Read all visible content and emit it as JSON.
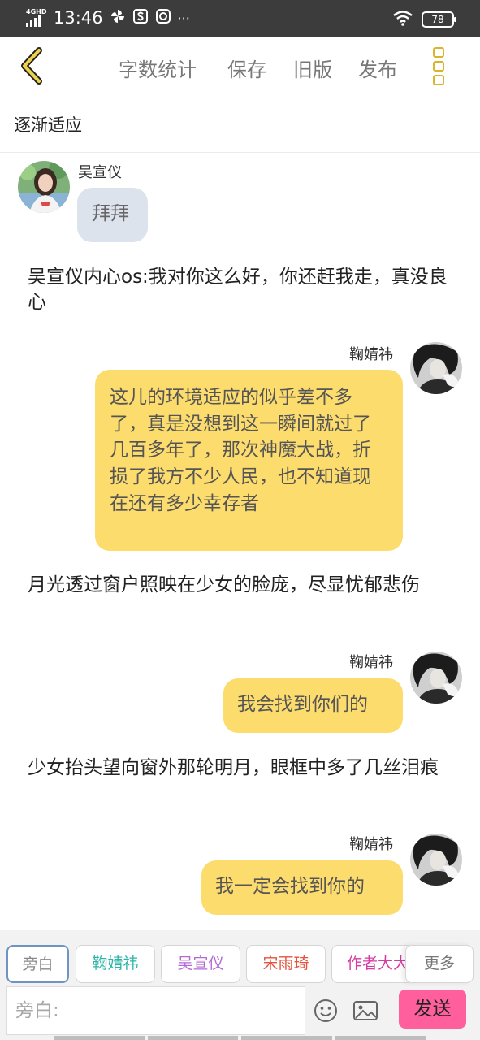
{
  "status_bar": {
    "network": "4GHD",
    "time": "13:46",
    "icons": [
      "pinwheel-icon",
      "s-box-icon",
      "chat-bubble-icon",
      "more-dots-icon"
    ],
    "more_text": "···",
    "battery": "78"
  },
  "toolbar": {
    "word_count": "字数统计",
    "save": "保存",
    "old_version": "旧版",
    "publish": "发布"
  },
  "chapter": {
    "title": "逐渐适应"
  },
  "messages": [
    {
      "type": "left",
      "name": "吴宣仪",
      "text": "拜拜"
    },
    {
      "type": "narration",
      "text": "吴宣仪内心os:我对你这么好，你还赶我走，真没良心"
    },
    {
      "type": "right",
      "name": "鞠婧祎",
      "text": "这儿的环境适应的似乎差不多了，真是没想到这一瞬间就过了几百多年了，那次神魔大战，折损了我方不少人民，也不知道现在还有多少幸存者"
    },
    {
      "type": "narration",
      "text": "月光透过窗户照映在少女的脸庞，尽显忧郁悲伤"
    },
    {
      "type": "right",
      "name": "鞠婧祎",
      "text": "我会找到你们的"
    },
    {
      "type": "narration",
      "text": "少女抬头望向窗外那轮明月，眼框中多了几丝泪痕"
    },
    {
      "type": "right",
      "name": "鞠婧祎",
      "text": "我一定会找到你的"
    }
  ],
  "roles": [
    {
      "label": "旁白",
      "color": "#888888"
    },
    {
      "label": "鞠婧祎",
      "color": "#2bb5a6"
    },
    {
      "label": "吴宣仪",
      "color": "#b36ad3"
    },
    {
      "label": "宋雨琦",
      "color": "#e5533c"
    },
    {
      "label": "作者大大",
      "color": "#d83aa2"
    }
  ],
  "roles_more": "更多",
  "composer": {
    "placeholder": "旁白:",
    "send": "发送"
  },
  "accent_colors": {
    "narration_bubble": "#fddc6e",
    "left_bubble": "#dde3ed",
    "send_button": "#ff5f9c",
    "menu_icon": "#d8b52a"
  }
}
